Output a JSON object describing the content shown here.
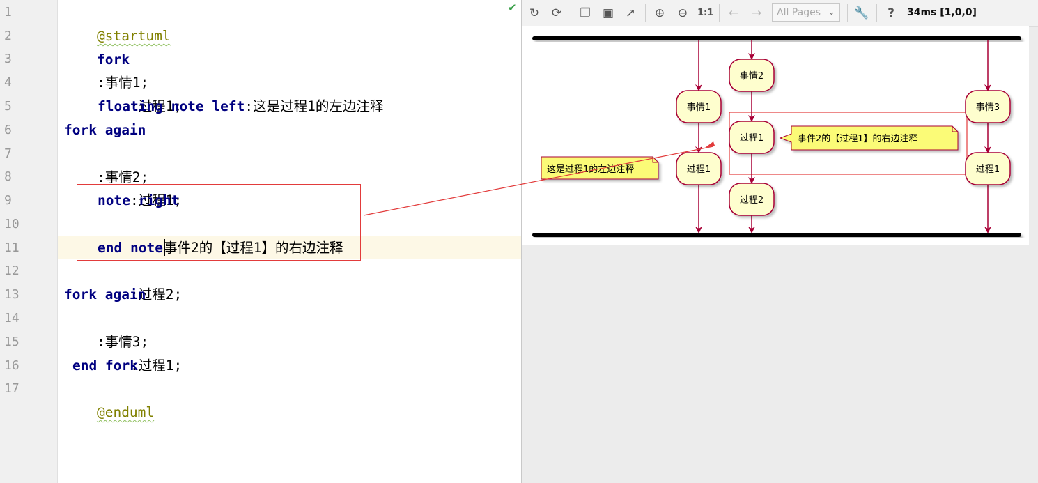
{
  "editor": {
    "line_numbers": [
      "1",
      "2",
      "3",
      "4",
      "5",
      "6",
      "7",
      "8",
      "9",
      "10",
      "11",
      "12",
      "13",
      "14",
      "15",
      "16",
      "17"
    ],
    "lines": [
      {
        "parts": [
          "@startuml"
        ]
      },
      {
        "parts": [
          "fork"
        ]
      },
      {
        "parts": [
          ":事情1;"
        ]
      },
      {
        "parts": [
          ":过程1;"
        ]
      },
      {
        "parts": [
          "floating",
          " ",
          "note",
          " ",
          "left",
          ":这是过程1的左边注释"
        ]
      },
      {
        "parts": [
          "fork",
          " ",
          "again"
        ]
      },
      {
        "parts": [
          ":事情2;"
        ]
      },
      {
        "parts": [
          ":过程1;"
        ]
      },
      {
        "parts": [
          "note",
          " ",
          "right"
        ]
      },
      {
        "parts": [
          "事件2的【过程1】的右边注释"
        ]
      },
      {
        "parts": [
          "end",
          " ",
          "note"
        ]
      },
      {
        "parts": [
          ":过程2;"
        ]
      },
      {
        "parts": [
          "fork",
          " ",
          "again"
        ]
      },
      {
        "parts": [
          ":事情3;"
        ]
      },
      {
        "parts": [
          ":过程1;"
        ]
      },
      {
        "parts": [
          "end",
          " ",
          "fork"
        ]
      },
      {
        "parts": [
          "@enduml"
        ]
      }
    ]
  },
  "toolbar": {
    "icons": [
      "refresh-icon",
      "sync-icon",
      "copy-icon",
      "save-icon",
      "export-icon",
      "zoom-in-icon",
      "zoom-out-icon",
      "actual-size-icon",
      "back-arrow-icon",
      "forward-arrow-icon",
      "settings-wrench-icon",
      "help-icon"
    ],
    "actual_size_label": "1:1",
    "pages_select": "All Pages",
    "help_label": "?",
    "timing": "34ms [1,0,0]"
  },
  "diagram": {
    "activities": {
      "e1": "事情1",
      "e2": "事情2",
      "e3": "事情3",
      "p1_left": "过程1",
      "p1_mid": "过程1",
      "p1_right": "过程1",
      "p2_mid": "过程2"
    },
    "notes": {
      "left": "这是过程1的左边注释",
      "right": "事件2的【过程1】的右边注释"
    },
    "colors": {
      "activity_fill": "#fefece",
      "activity_border": "#a80036",
      "note_fill": "#fbfb77",
      "bar": "#000000",
      "highlight": "#e23b3b"
    }
  }
}
